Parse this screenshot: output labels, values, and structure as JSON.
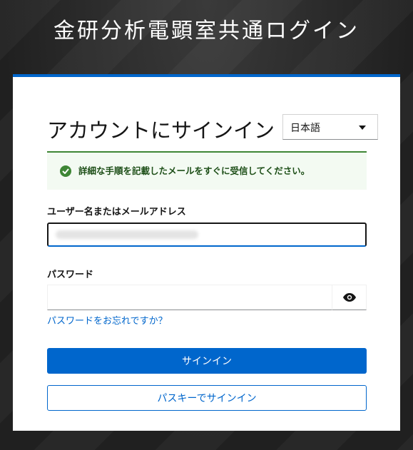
{
  "brand": {
    "title": "金研分析電顕室共通ログイン"
  },
  "login": {
    "heading": "アカウントにサインイン",
    "language": {
      "selected": "日本語",
      "icon": "chevron-down-icon"
    },
    "alert": {
      "icon": "check-circle-icon",
      "message": "詳細な手順を記載したメールをすぐに受信してください。",
      "color": "#3e8635"
    },
    "username": {
      "label": "ユーザー名またはメールアドレス",
      "value": ""
    },
    "password": {
      "label": "パスワード",
      "value": "",
      "toggle_icon": "eye-icon"
    },
    "forgot_link": "パスワードをお忘れですか？",
    "signin_button": "サインイン",
    "passkey_button": "パスキーでサインイン"
  },
  "colors": {
    "accent": "#0066cc",
    "success": "#3e8635",
    "background": "#262626"
  }
}
